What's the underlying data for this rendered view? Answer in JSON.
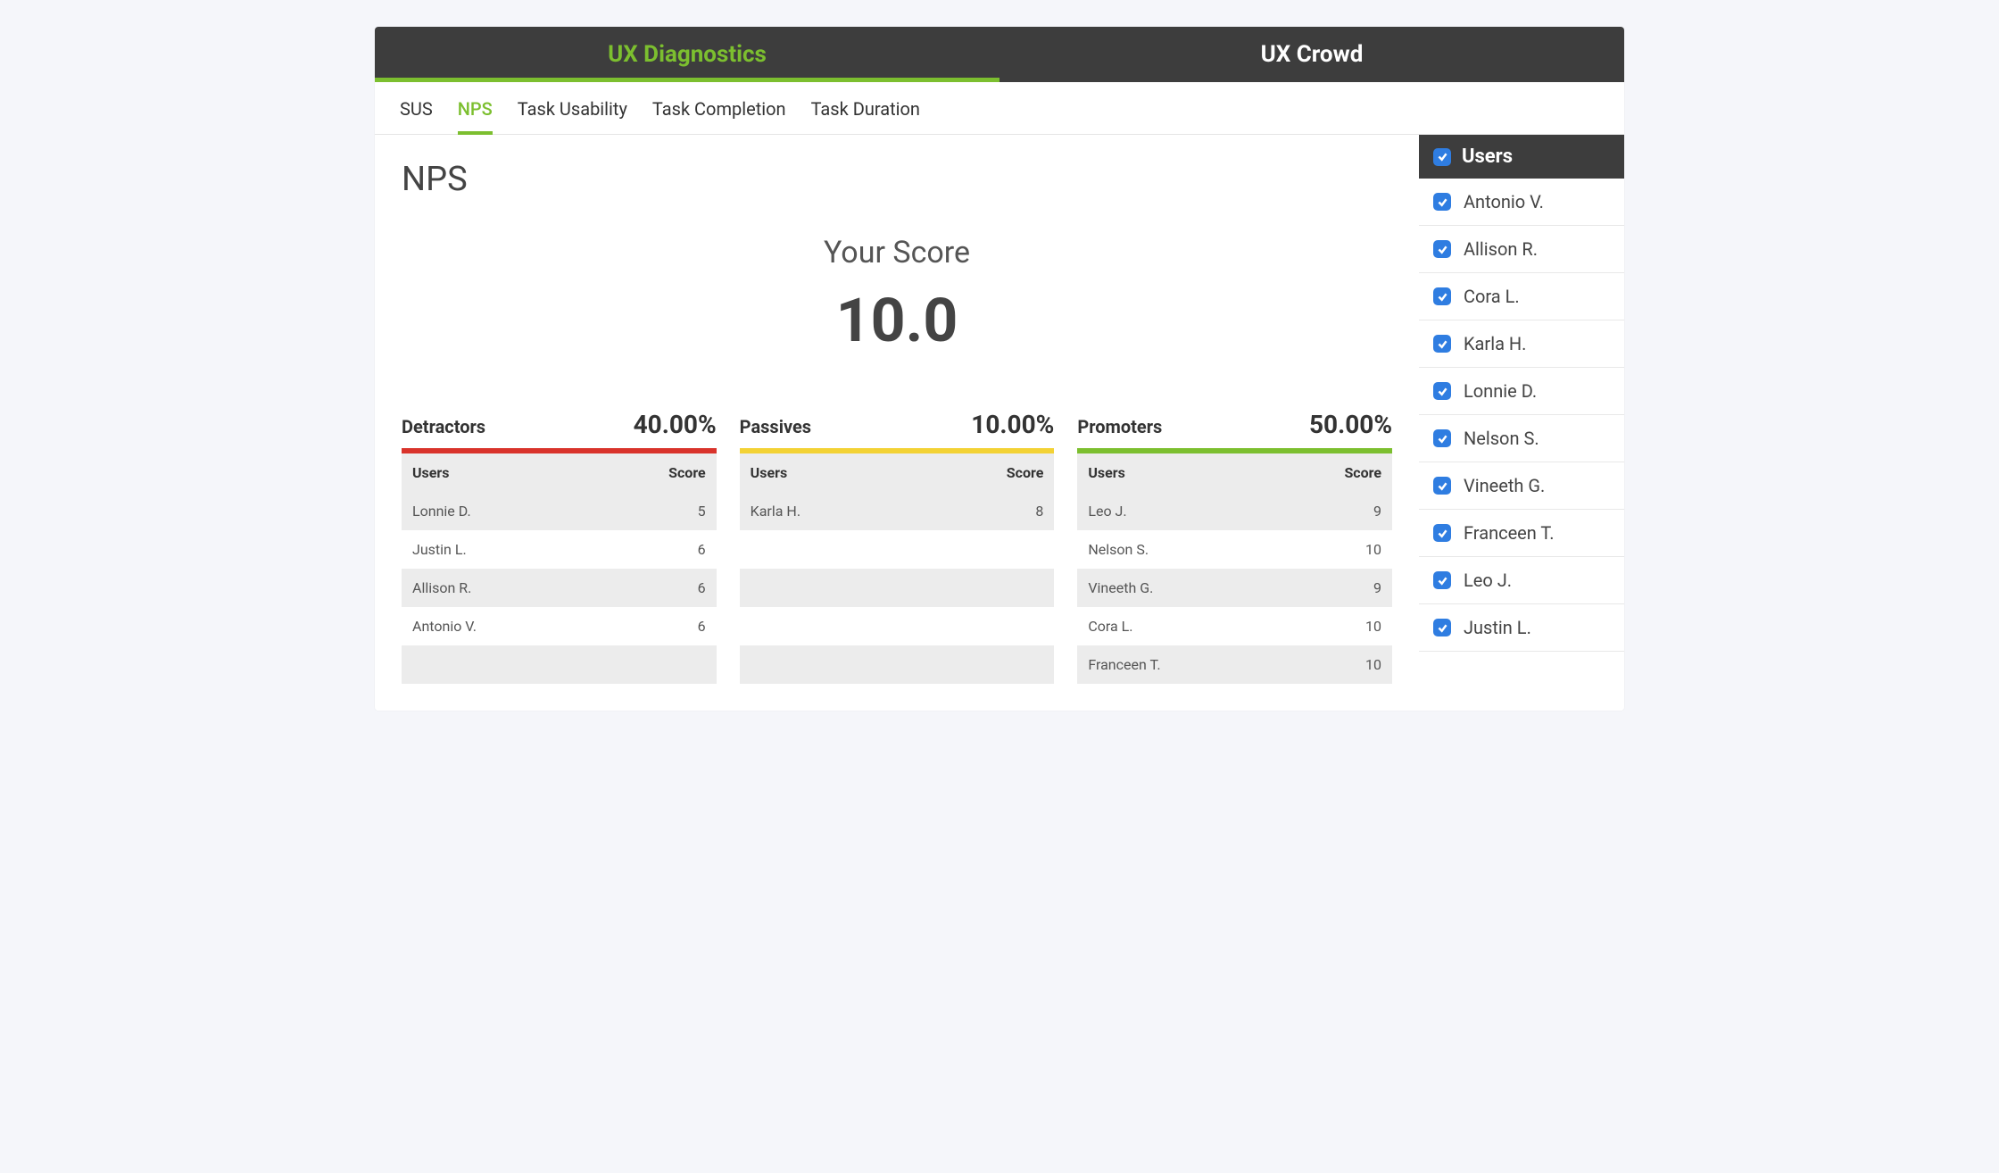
{
  "topbar": {
    "tabs": [
      {
        "label": "UX Diagnostics",
        "active": true
      },
      {
        "label": "UX Crowd",
        "active": false
      }
    ]
  },
  "subtabs": [
    {
      "label": "SUS",
      "active": false
    },
    {
      "label": "NPS",
      "active": true
    },
    {
      "label": "Task Usability",
      "active": false
    },
    {
      "label": "Task Completion",
      "active": false
    },
    {
      "label": "Task Duration",
      "active": false
    }
  ],
  "page_title": "NPS",
  "score": {
    "label": "Your Score",
    "value": "10.0"
  },
  "columns": {
    "users": "Users",
    "score": "Score"
  },
  "groups": [
    {
      "title": "Detractors",
      "pct": "40.00%",
      "color": "red",
      "rows": [
        {
          "user": "Lonnie D.",
          "score": "5"
        },
        {
          "user": "Justin L.",
          "score": "6"
        },
        {
          "user": "Allison R.",
          "score": "6"
        },
        {
          "user": "Antonio V.",
          "score": "6"
        },
        {
          "user": "",
          "score": ""
        }
      ]
    },
    {
      "title": "Passives",
      "pct": "10.00%",
      "color": "yellow",
      "rows": [
        {
          "user": "Karla H.",
          "score": "8"
        },
        {
          "user": "",
          "score": ""
        },
        {
          "user": "",
          "score": ""
        },
        {
          "user": "",
          "score": ""
        },
        {
          "user": "",
          "score": ""
        }
      ]
    },
    {
      "title": "Promoters",
      "pct": "50.00%",
      "color": "green",
      "rows": [
        {
          "user": "Leo J.",
          "score": "9"
        },
        {
          "user": "Nelson S.",
          "score": "10"
        },
        {
          "user": "Vineeth G.",
          "score": "9"
        },
        {
          "user": "Cora L.",
          "score": "10"
        },
        {
          "user": "Franceen T.",
          "score": "10"
        }
      ]
    }
  ],
  "sidebar": {
    "title": "Users",
    "all_checked": true,
    "users": [
      "Antonio V.",
      "Allison R.",
      "Cora L.",
      "Karla H.",
      "Lonnie D.",
      "Nelson S.",
      "Vineeth G.",
      "Franceen T.",
      "Leo J.",
      "Justin L."
    ]
  }
}
